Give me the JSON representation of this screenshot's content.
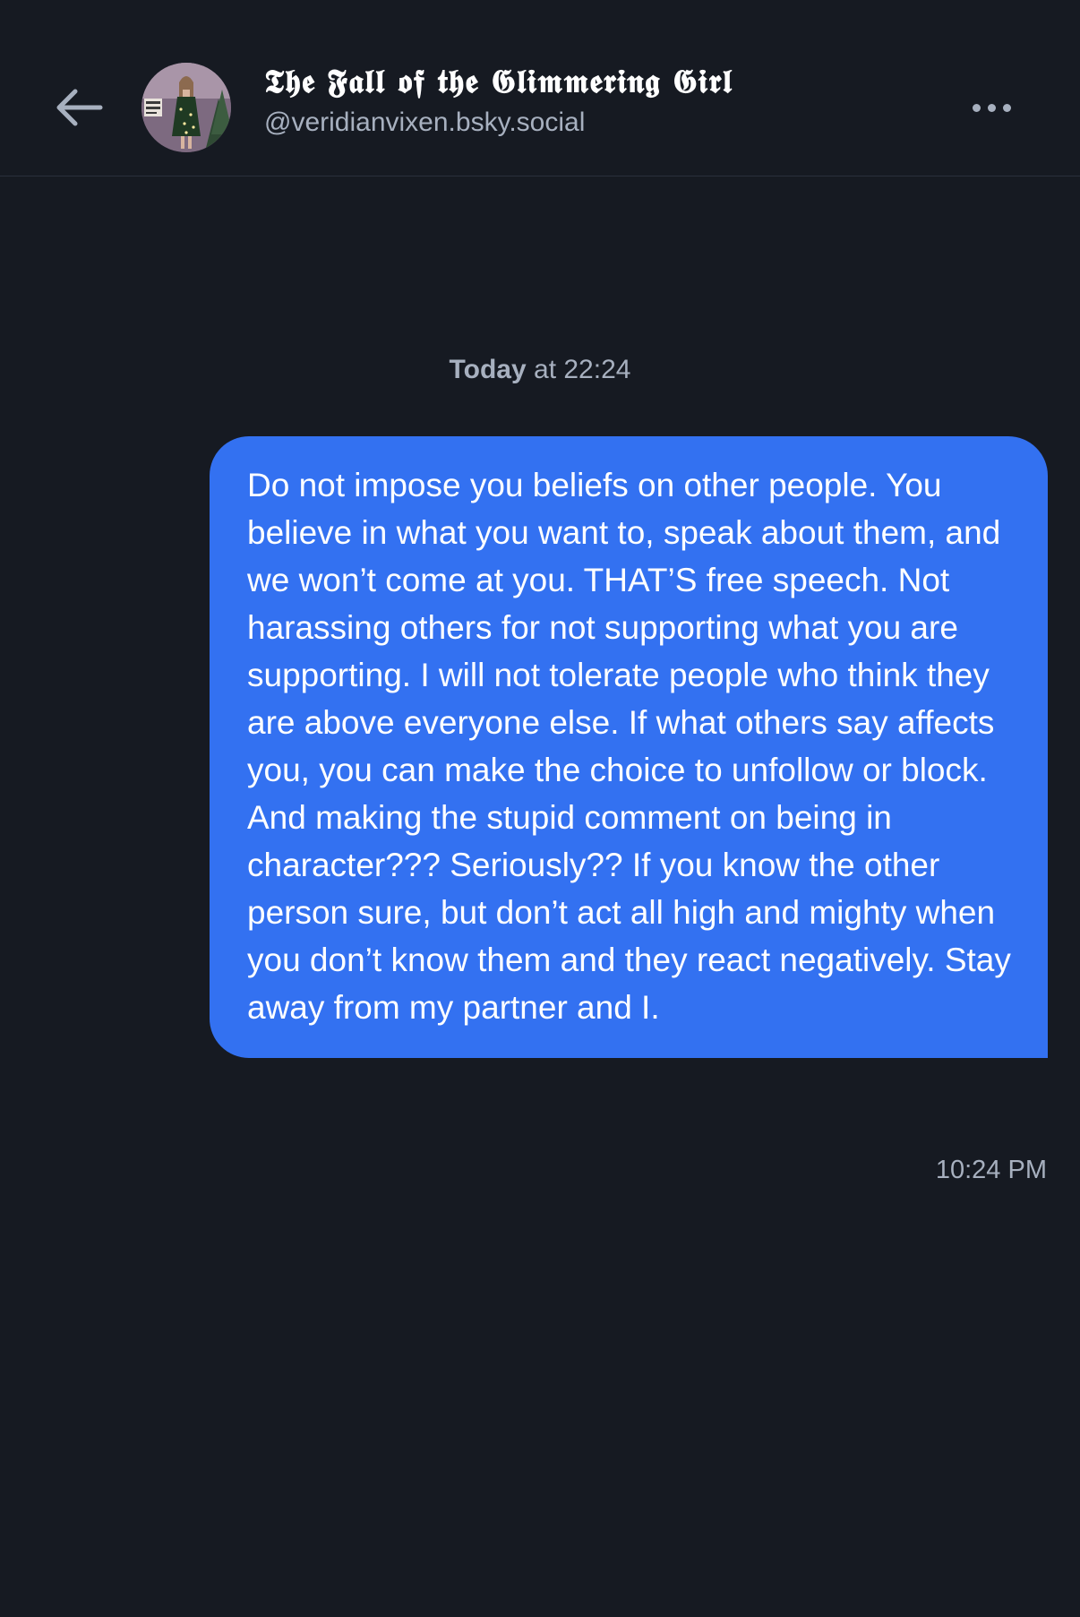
{
  "header": {
    "back_icon": "arrow-left-icon",
    "display_name": "𝕿𝖍𝖊 𝕱𝖆𝖑𝖑 𝖔𝖋 𝖙𝖍𝖊 𝕲𝖑𝖎𝖒𝖒𝖊𝖗𝖎𝖓𝖌 𝕲𝖎𝖗𝖑",
    "handle": "@veridianvixen.bsky.social",
    "more_icon": "ellipsis-icon"
  },
  "conversation": {
    "date_bold": "Today",
    "date_rest": " at 22:24",
    "messages": [
      {
        "text": "Do not impose you beliefs on other people. You believe in what you want to, speak about them, and we won’t come at you. THAT’S free speech. Not harassing others for not supporting what you are supporting. I will not tolerate people who think they are above everyone else. If what others say affects you, you can make the choice to unfollow or block. And making the stupid comment on being in character??? Seriously?? If you know the other person sure, but don’t act all high and mighty when you don’t know them and they react negatively. Stay away from my partner and I.",
        "time": "10:24 PM"
      }
    ]
  },
  "colors": {
    "background": "#161a22",
    "bubble": "#3371f1",
    "secondary_text": "#a7b0bf"
  }
}
